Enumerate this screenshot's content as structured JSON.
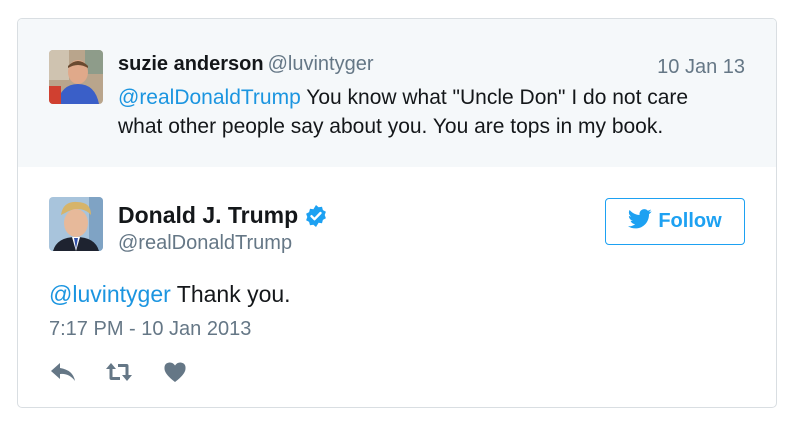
{
  "quoted_tweet": {
    "name": "suzie anderson",
    "handle": "@luvintyger",
    "date": "10 Jan 13",
    "mention": "@realDonaldTrump",
    "text": " You know what \"Uncle Don\" I do not care what other people say about you. You are tops in my book.",
    "avatar_icon": "user-photo"
  },
  "main_tweet": {
    "name": "Donald J. Trump",
    "handle": "@realDonaldTrump",
    "verified_icon": "verified-badge-icon",
    "follow_label": "Follow",
    "mention": "@luvintyger",
    "text": " Thank you.",
    "timestamp": "7:17 PM - 10 Jan 2013",
    "avatar_icon": "user-photo"
  },
  "actions": {
    "reply_icon": "reply-icon",
    "retweet_icon": "retweet-icon",
    "like_icon": "heart-icon"
  },
  "colors": {
    "accent": "#1da1f2",
    "mention": "#1b95e0",
    "muted": "#657786",
    "quoted_bg": "#f5f8fa"
  }
}
